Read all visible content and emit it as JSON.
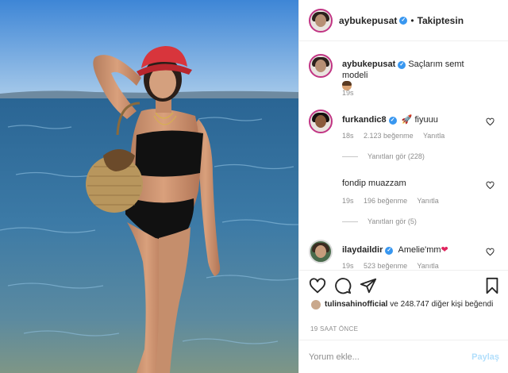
{
  "post": {
    "author": "aybukepusat",
    "follow_state": "Takiptesin",
    "separator": "•",
    "verified_mark": "✓"
  },
  "caption": {
    "author": "aybukepusat",
    "text": "Saçlarım semt modeli",
    "time": "19s"
  },
  "comments": [
    {
      "user": "furkandic8",
      "text": "fiyuuu",
      "icon": "rocket-icon",
      "time": "18s",
      "likes": "2.123 beğenme",
      "reply_label": "Yanıtla",
      "view_replies": "Yanıtları gör (228)"
    },
    {
      "user": "",
      "text": "fondip muazzam",
      "time": "19s",
      "likes": "196 beğenme",
      "reply_label": "Yanıtla",
      "view_replies": "Yanıtları gör (5)"
    },
    {
      "user": "ilaydaildir",
      "text": "Amelie'mm",
      "icon": "heart-emoji-icon",
      "time": "19s",
      "likes": "523 beğenme",
      "reply_label": "Yanıtla"
    }
  ],
  "actions": {
    "liked_by_user": "tulinsahinofficial",
    "liked_by_rest": "ve 248.747 diğer kişi beğendi",
    "time_ago": "19 SAAT ÖNCE"
  },
  "add_comment": {
    "placeholder": "Yorum ekle...",
    "post_label": "Paylaş"
  },
  "colors": {
    "accent_blue": "#3897f0",
    "post_button_disabled": "#b2dffc",
    "story_ring": "#c13584",
    "heart_red": "#e0245e"
  }
}
